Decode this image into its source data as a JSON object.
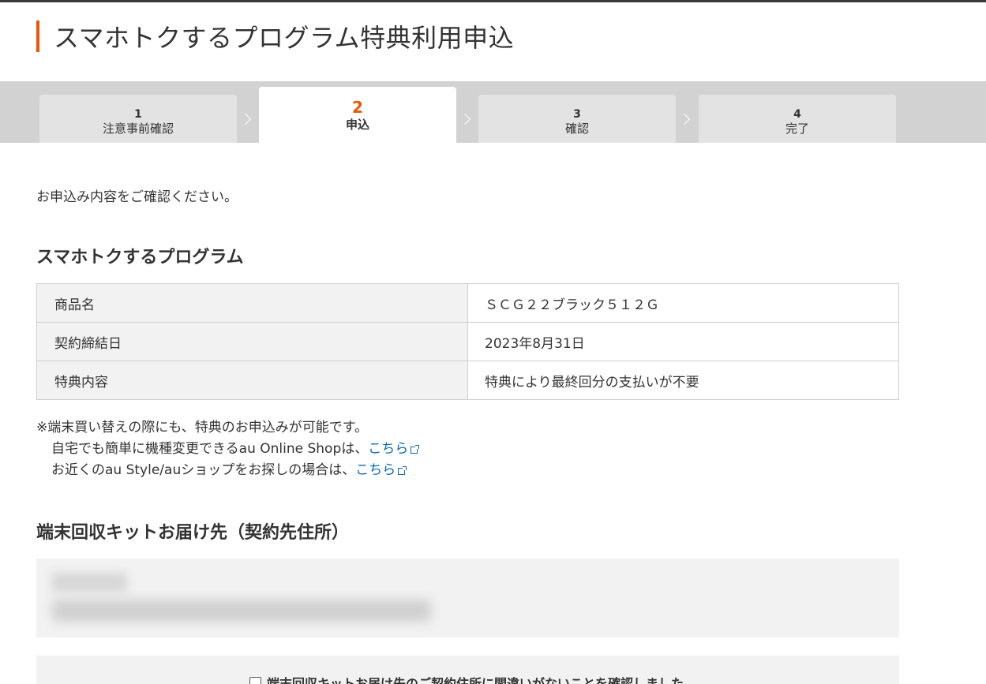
{
  "page": {
    "title": "スマホトクするプログラム特典利用申込",
    "accent_color": "#eb5505"
  },
  "steps": [
    {
      "num": "1",
      "label": "注意事前確認",
      "active": false
    },
    {
      "num": "2",
      "label": "申込",
      "active": true
    },
    {
      "num": "3",
      "label": "確認",
      "active": false
    },
    {
      "num": "4",
      "label": "完了",
      "active": false
    }
  ],
  "intro": "お申込み内容をご確認ください。",
  "program": {
    "title": "スマホトクするプログラム",
    "rows": [
      {
        "label": "商品名",
        "value": "ＳＣＧ２２ブラック５１２Ｇ"
      },
      {
        "label": "契約締結日",
        "value": "2023年8月31日"
      },
      {
        "label": "特典内容",
        "value": "特典により最終回分の支払いが不要"
      }
    ]
  },
  "notes": {
    "line1": "※端末買い替えの際にも、特典のお申込みが可能です。",
    "line2_text": "自宅でも簡単に機種変更できるau Online Shopは、",
    "line2_link": "こちら",
    "line3_text": "お近くのau Style/auショップをお探しの場合は、",
    "line3_link": "こちら",
    "link_color": "#0b67b2"
  },
  "address": {
    "title": "端末回収キットお届け先（契約先住所）"
  },
  "confirm": {
    "label": "端末回収キットお届け先のご契約住所に間違いがないことを確認しました",
    "checked": false
  }
}
